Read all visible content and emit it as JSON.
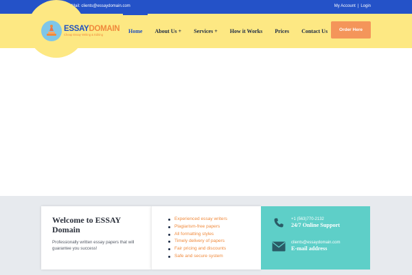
{
  "topbar": {
    "mail_label": "Mail:",
    "mail_value": "clients@essaydomain.com",
    "my_account": "My Account",
    "separator": "|",
    "login": "Login"
  },
  "logo": {
    "word1": "ESSAY",
    "word2": "DOMAIN",
    "tagline": "Cheap Essay Writing & Editing"
  },
  "nav": {
    "items": [
      {
        "label": "Home",
        "active": true
      },
      {
        "label": "About Us +",
        "active": false
      },
      {
        "label": "Services +",
        "active": false
      },
      {
        "label": "How it Works",
        "active": false
      },
      {
        "label": "Prices",
        "active": false
      },
      {
        "label": "Contact Us",
        "active": false
      }
    ],
    "order_button": "Order Here"
  },
  "welcome": {
    "title": "Welcome to ESSAY Domain",
    "text": "Professionally written essay papers that will guarantee you success!"
  },
  "features": [
    "Experienced essay writers",
    "Plagiarism-free papers",
    "All formatting styles",
    "Timely delivery of papers",
    "Fair pricing and discounts",
    "Safe and secure system"
  ],
  "contact": {
    "phone": "+1 (563)770-2132",
    "phone_label": "24/7 Online Support",
    "email": "clients@essaydomain.com",
    "email_label": "E-mail address"
  },
  "colors": {
    "topbar": "#2452c8",
    "header": "#fde883",
    "accent_orange": "#f08a3c",
    "order_button": "#f4955a",
    "contact_card": "#5ecfc8",
    "band": "#e7eaee"
  }
}
